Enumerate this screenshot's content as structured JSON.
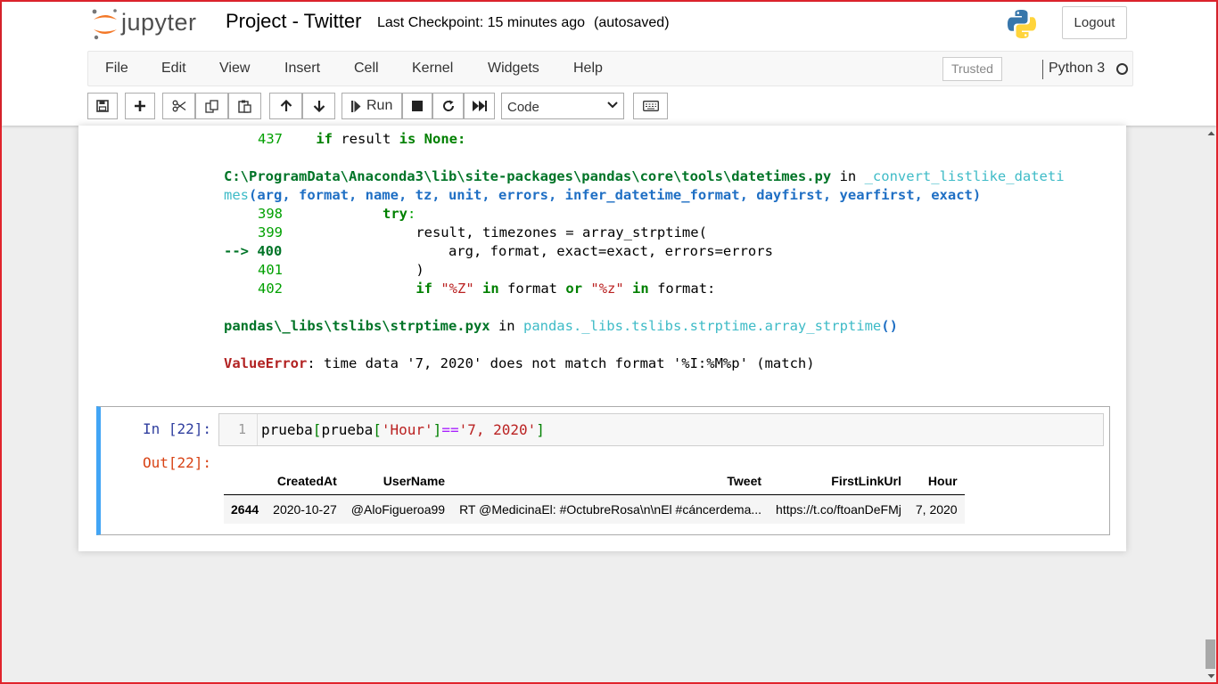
{
  "header": {
    "brand": "jupyter",
    "notebook_title": "Project - Twitter",
    "checkpoint_text": "Last Checkpoint: 15 minutes ago",
    "autosave_text": "(autosaved)",
    "logout_label": "Logout"
  },
  "menu": {
    "items": [
      "File",
      "Edit",
      "View",
      "Insert",
      "Cell",
      "Kernel",
      "Widgets",
      "Help"
    ],
    "trusted_label": "Trusted",
    "kernel_name": "Python 3"
  },
  "toolbar": {
    "run_label": "Run",
    "cell_type": "Code",
    "icons": [
      "save-icon",
      "plus-icon",
      "cut-icon",
      "copy-icon",
      "paste-icon",
      "arrow-up-icon",
      "arrow-down-icon",
      "run-icon",
      "stop-icon",
      "restart-icon",
      "fast-forward-icon",
      "keyboard-icon"
    ]
  },
  "traceback": {
    "l437_no": "437",
    "l437_kw1": "if",
    "l437_mid": " result ",
    "l437_kw2": "is",
    "l437_kw3": "None",
    "l437_colon": ":",
    "file1_path": "C:\\ProgramData\\Anaconda3\\lib\\site-packages\\pandas\\core\\tools\\datetimes.py",
    "file1_in": "in",
    "file1_func_a": "_convert_listlike_dateti",
    "file1_func_b": "mes",
    "file1_args": "(arg, format, name, tz, unit, errors, infer_datetime_format, dayfirst, yearfirst, exact)",
    "l398_no": "398",
    "l398_kw": "try",
    "l398_colon": ":",
    "l399_no": "399",
    "l399_code": "result, timezones = array_strptime(",
    "l400_arrow": "--> 400",
    "l400_code": "arg, format, exact=exact, errors=errors",
    "l401_no": "401",
    "l401_code": ")",
    "l402_no": "402",
    "l402_kw_if": "if",
    "l402_s1": "\"%Z\"",
    "l402_kw_in": "in",
    "l402_w1": "format",
    "l402_kw_or": "or",
    "l402_s2": "\"%z\"",
    "l402_kw_in2": "in",
    "l402_w2": "format:",
    "file2_path": "pandas\\_libs\\tslibs\\strptime.pyx",
    "file2_in": "in",
    "file2_func": "pandas._libs.tslibs.strptime.array_strptime",
    "file2_paren": "()",
    "error_type": "ValueError",
    "error_message": ": time data '7, 2020' does not match format '%I:%M%p' (match)"
  },
  "cell": {
    "in_prompt": "In [22]:",
    "out_prompt": "Out[22]:",
    "line_number": "1",
    "code_p1": "prueba",
    "code_p2": "[",
    "code_p3": "prueba",
    "code_p4": "[",
    "code_p5": "'Hour'",
    "code_p6": "]",
    "code_p7": "==",
    "code_p8": "'7, 2020'",
    "code_p9": "]"
  },
  "table": {
    "columns": [
      "",
      "CreatedAt",
      "UserName",
      "Tweet",
      "FirstLinkUrl",
      "Hour"
    ],
    "rows": [
      [
        "2644",
        "2020-10-27",
        "@AloFigueroa99",
        "RT @MedicinaEl: #OctubreRosa\\n\\nEl #cáncerdema...",
        "https://t.co/ftoanDeFMj",
        "7, 2020"
      ]
    ]
  }
}
